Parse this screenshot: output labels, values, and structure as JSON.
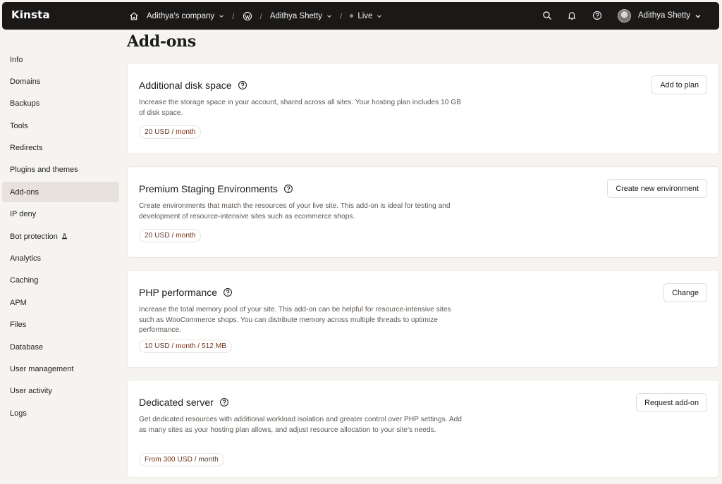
{
  "topbar": {
    "logo": "Kinsta",
    "company": "Adithya's company",
    "site": "Adithya Shetty",
    "environment": "Live",
    "user": "Adithya Shetty",
    "icons": [
      "home-icon",
      "wordpress-icon",
      "search-icon",
      "bell-icon",
      "help-icon",
      "chevron-down-icon"
    ]
  },
  "sidebar": {
    "items": [
      {
        "label": "Info"
      },
      {
        "label": "Domains"
      },
      {
        "label": "Backups"
      },
      {
        "label": "Tools"
      },
      {
        "label": "Redirects"
      },
      {
        "label": "Plugins and themes"
      },
      {
        "label": "Add-ons",
        "active": true
      },
      {
        "label": "IP deny"
      },
      {
        "label": "Bot protection"
      },
      {
        "label": "Analytics"
      },
      {
        "label": "Caching"
      },
      {
        "label": "APM"
      },
      {
        "label": "Files"
      },
      {
        "label": "Database"
      },
      {
        "label": "User management"
      },
      {
        "label": "User activity"
      },
      {
        "label": "Logs"
      }
    ]
  },
  "main": {
    "title": "Add-ons",
    "cards": [
      {
        "title": "Additional disk space",
        "description": "Increase the storage space in your account, shared across all sites. Your hosting plan includes 10 GB of disk space.",
        "price": "20 USD / month",
        "button": "Add to plan"
      },
      {
        "title": "Premium Staging Environments",
        "description": "Create environments that match the resources of your live site. This add-on is ideal for testing and development of resource-intensive sites such as ecommerce shops.",
        "price": "20 USD / month",
        "button": "Create new environment"
      },
      {
        "title": "PHP performance",
        "description": "Increase the total memory pool of your site. This add-on can be helpful for resource-intensive sites such as WooCommerce shops. You can distribute memory across multiple threads to optimize performance.",
        "price": "10 USD / month / 512 MB",
        "button": "Change"
      },
      {
        "title": "Dedicated server",
        "description": "Get dedicated resources with additional workload isolation and greater control over PHP settings. Add as many sites as your hosting plan allows, and adjust resource allocation to your site's needs.",
        "price": "From 300 USD / month",
        "button": "Request add-on"
      }
    ]
  },
  "colors": {
    "topbar": "#1b1918",
    "background": "#f6f4f1",
    "active_item": "#e8e2dc",
    "price_text": "#6a3622"
  }
}
